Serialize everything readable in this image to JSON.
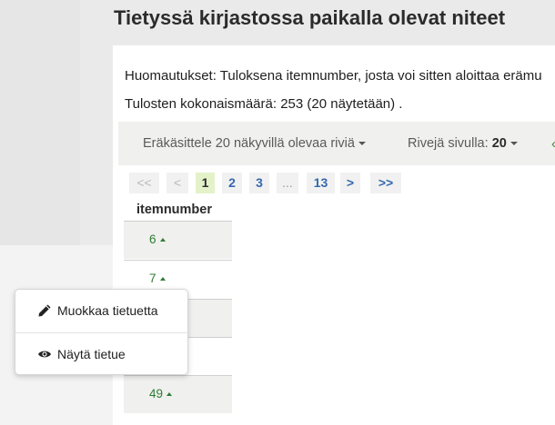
{
  "page": {
    "title": "Tietyssä kirjastossa paikalla olevat niteet"
  },
  "notes": {
    "remarks_label": "Huomautukset:",
    "remarks_text": "Tuloksena itemnumber, josta voi sitten aloittaa erämu",
    "total_label": "Tulosten kokonaismäärä:",
    "total_text": "253 (20 näytetään) ."
  },
  "toolbar": {
    "batch_label": "Eräkäsittele 20 näkyvillä olevaa riviä",
    "rows_label": "Rivejä sivulla:",
    "rows_value": "20",
    "more_glyph": "‹"
  },
  "pagination": {
    "first": "<<",
    "prev": "<",
    "pages": [
      "1",
      "2",
      "3"
    ],
    "ellipsis": "...",
    "last_page": "13",
    "next": ">",
    "last": ">>",
    "current": "1"
  },
  "table": {
    "column_header": "itemnumber",
    "rows": [
      "6",
      "7",
      "",
      "",
      "49"
    ]
  },
  "context_menu": {
    "items": [
      {
        "label": "Muokkaa tietuetta",
        "icon": "pencil-icon"
      },
      {
        "label": "Näytä tietue",
        "icon": "eye-icon"
      }
    ]
  },
  "colors": {
    "accent_green": "#2e7d32",
    "link_blue": "#3568b0",
    "current_page_bg": "#e4f2c9"
  }
}
